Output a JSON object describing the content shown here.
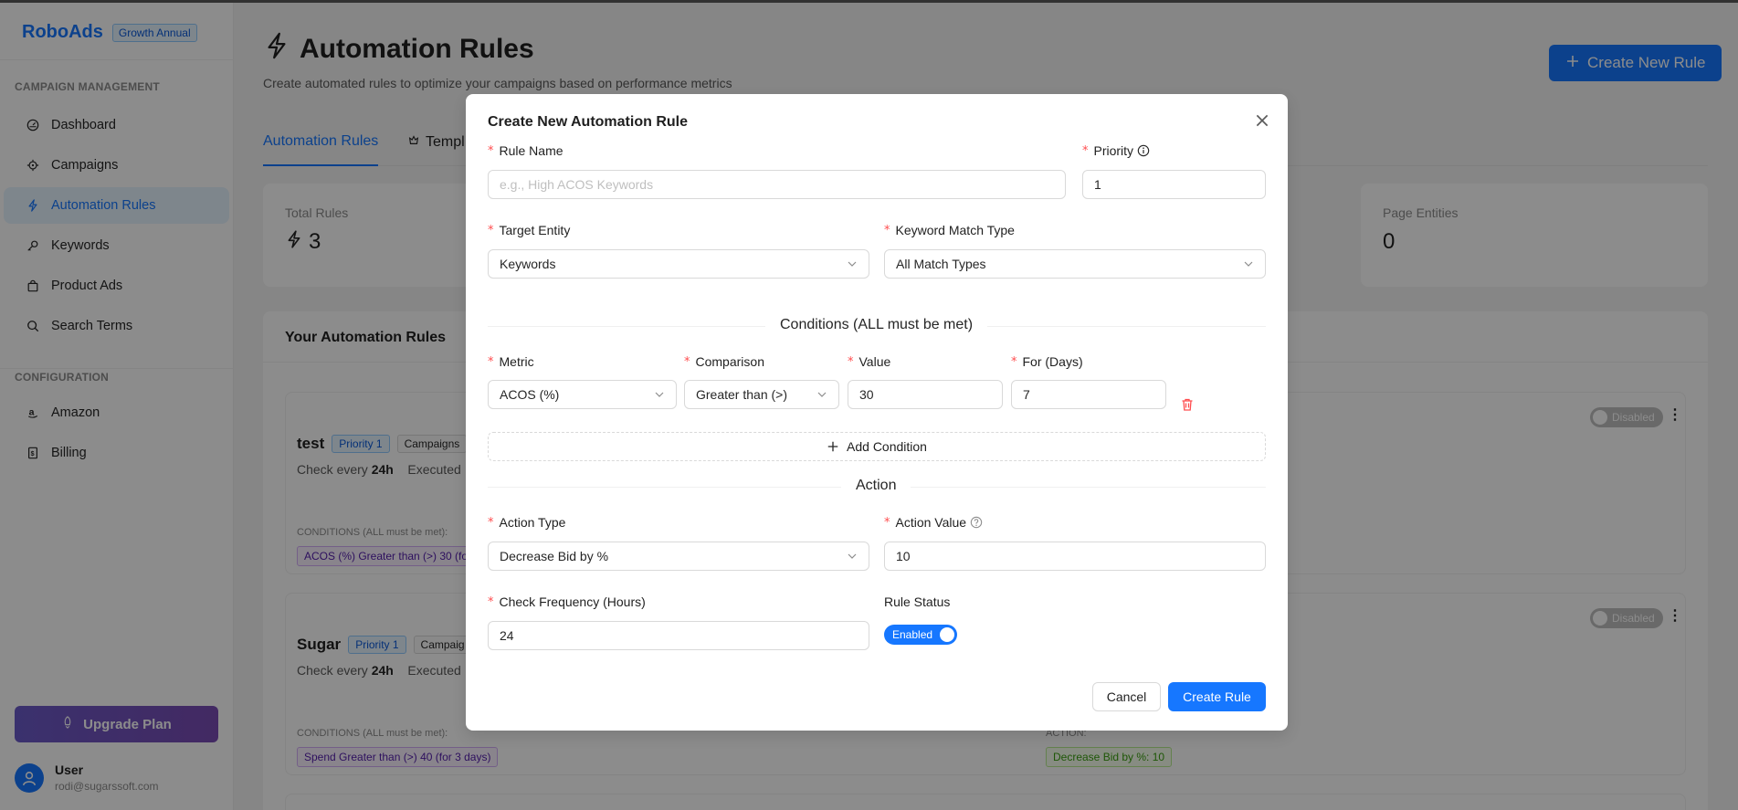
{
  "app": {
    "brand": "RoboAds",
    "plan_badge": "Growth Annual"
  },
  "sidebar": {
    "section1": "CAMPAIGN MANAGEMENT",
    "items": [
      {
        "label": "Dashboard",
        "icon": "dashboard-icon"
      },
      {
        "label": "Campaigns",
        "icon": "target-icon"
      },
      {
        "label": "Automation Rules",
        "icon": "thunderbolt-icon",
        "active": true
      },
      {
        "label": "Keywords",
        "icon": "key-icon"
      },
      {
        "label": "Product Ads",
        "icon": "shopping-icon"
      },
      {
        "label": "Search Terms",
        "icon": "search-icon"
      }
    ],
    "section2": "CONFIGURATION",
    "config_items": [
      {
        "label": "Amazon",
        "icon": "amazon-icon"
      },
      {
        "label": "Billing",
        "icon": "billing-icon"
      }
    ],
    "upgrade_label": "Upgrade Plan",
    "user": {
      "name": "User",
      "email": "rodi@sugarssoft.com"
    }
  },
  "main": {
    "title": "Automation Rules",
    "subtitle": "Create automated rules to optimize your campaigns based on performance metrics",
    "create_button": "Create New Rule",
    "tabs": [
      {
        "label": "Automation Rules",
        "active": true
      },
      {
        "label": "Templ"
      }
    ],
    "stats": [
      {
        "label": "Total Rules",
        "value": "3"
      },
      {
        "label": "Page Entities",
        "value": "0"
      }
    ],
    "rules_header": "Your Automation Rules",
    "rules": [
      {
        "name": "test",
        "priority": "Priority 1",
        "scope": "Campaigns",
        "check_prefix": "Check every",
        "check_value": "24h",
        "executed": "Executed",
        "conditions_label": "CONDITIONS (ALL must be met):",
        "condition": "ACOS (%) Greater than (>) 30 (fo",
        "status": "Disabled"
      },
      {
        "name": "Sugar",
        "priority": "Priority 1",
        "scope": "Campaig",
        "check_prefix": "Check every",
        "check_value": "24h",
        "executed": "Executed",
        "conditions_label": "CONDITIONS (ALL must be met):",
        "condition": "Spend Greater than (>) 40 (for 3 days)",
        "action_label": "ACTION:",
        "action": "Decrease Bid by %: 10",
        "status": "Disabled"
      }
    ]
  },
  "modal": {
    "title": "Create New Automation Rule",
    "rule_name_label": "Rule Name",
    "rule_name_placeholder": "e.g., High ACOS Keywords",
    "priority_label": "Priority",
    "priority_value": "1",
    "target_entity_label": "Target Entity",
    "target_entity_value": "Keywords",
    "match_type_label": "Keyword Match Type",
    "match_type_value": "All Match Types",
    "conditions_divider": "Conditions (ALL must be met)",
    "metric_label": "Metric",
    "metric_value": "ACOS (%)",
    "comparison_label": "Comparison",
    "comparison_value": "Greater than (>)",
    "value_label": "Value",
    "value_value": "30",
    "days_label": "For (Days)",
    "days_value": "7",
    "add_condition": "Add Condition",
    "action_divider": "Action",
    "action_type_label": "Action Type",
    "action_type_value": "Decrease Bid by %",
    "action_value_label": "Action Value",
    "action_value_value": "10",
    "frequency_label": "Check Frequency (Hours)",
    "frequency_value": "24",
    "status_label": "Rule Status",
    "status_value": "Enabled",
    "cancel": "Cancel",
    "create": "Create Rule"
  },
  "colors": {
    "primary": "#1677ff",
    "required": "#ff4d4f",
    "delete": "#ff4d4f"
  }
}
